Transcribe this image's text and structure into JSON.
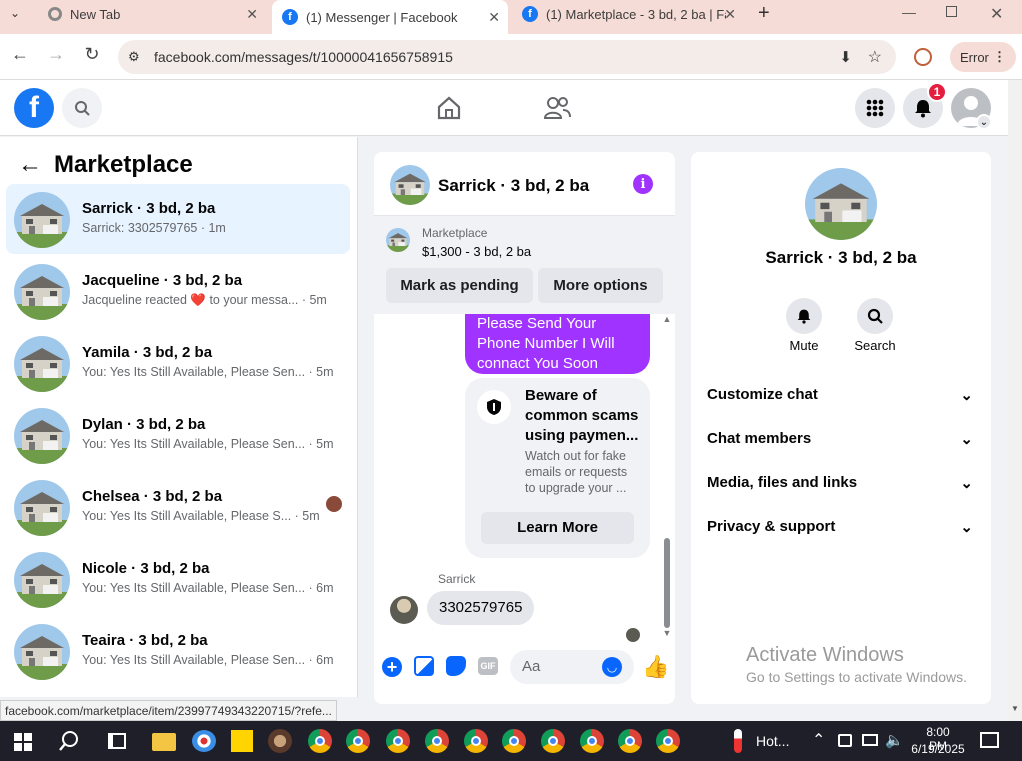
{
  "browser": {
    "tabs": [
      {
        "title": "New Tab"
      },
      {
        "title": "(1) Messenger | Facebook"
      },
      {
        "title": "(1) Marketplace - 3 bd, 2 ba | Fa"
      }
    ],
    "url": "facebook.com/messages/t/10000041656758915",
    "error_label": "Error"
  },
  "header": {
    "notif_count": "1"
  },
  "left_panel": {
    "title": "Marketplace",
    "conversations": [
      {
        "name": "Sarrick · 3 bd, 2 ba",
        "preview": "Sarrick: 3302579765 · 1m"
      },
      {
        "name": "Jacqueline · 3 bd, 2 ba",
        "preview": "Jacqueline reacted ❤️ to your messa... · 5m"
      },
      {
        "name": "Yamila · 3 bd, 2 ba",
        "preview": "You: Yes Its Still Available, Please Sen... · 5m"
      },
      {
        "name": "Dylan · 3 bd, 2 ba",
        "preview": "You: Yes Its Still Available, Please Sen... · 5m"
      },
      {
        "name": "Chelsea · 3 bd, 2 ba",
        "preview": "You: Yes Its Still Available, Please S... · 5m"
      },
      {
        "name": "Nicole · 3 bd, 2 ba",
        "preview": "You: Yes Its Still Available, Please Sen... · 6m"
      },
      {
        "name": "Teaira · 3 bd, 2 ba",
        "preview": "You: Yes Its Still Available, Please Sen... · 6m"
      }
    ]
  },
  "chat": {
    "title": "Sarrick · 3 bd, 2 ba",
    "listing_label": "Marketplace",
    "listing_price": "$1,300 - 3 bd, 2 ba",
    "mark_pending": "Mark as pending",
    "more_options": "More options",
    "sent_message": "Please Send Your Phone Number I Will connact You Soon",
    "warn_title": "Beware of common scams using paymen...",
    "warn_body": "Watch out for fake emails or requests to upgrade your ...",
    "learn_more": "Learn More",
    "sender_name": "Sarrick",
    "received_message": "3302579765",
    "input_placeholder": "Aa"
  },
  "profile": {
    "name": "Sarrick · 3 bd, 2 ba",
    "mute": "Mute",
    "search": "Search",
    "sections": [
      "Customize chat",
      "Chat members",
      "Media, files and links",
      "Privacy & support"
    ]
  },
  "watermark": {
    "line1": "Activate Windows",
    "line2": "Go to Settings to activate Windows."
  },
  "status_url": "facebook.com/marketplace/item/23997749343220715/?refe...",
  "taskbar": {
    "weather": "Hot...",
    "time": "8:00 PM",
    "date": "6/19/2025"
  },
  "colors": {
    "fb_blue": "#1877f2",
    "messenger_purple": "#a033ff",
    "selected_bg": "#e7f3ff"
  }
}
